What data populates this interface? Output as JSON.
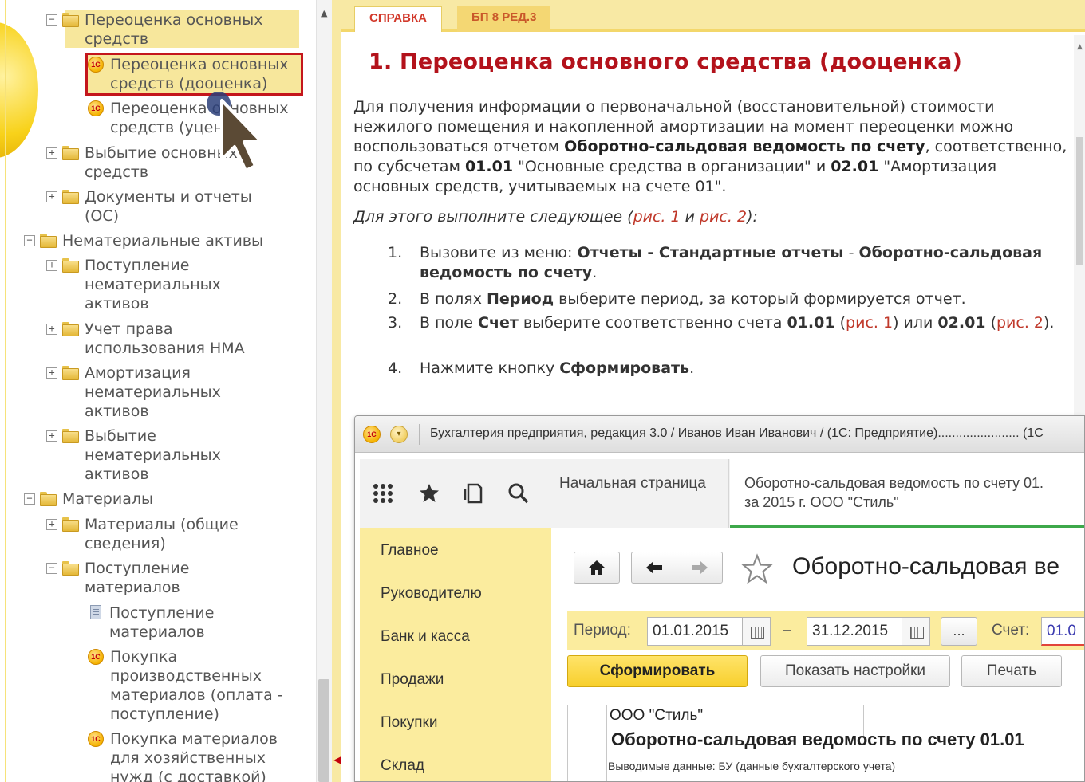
{
  "tree": {
    "items": [
      {
        "toggle": "−",
        "icon": "folder",
        "label": "Переоценка основных\nсредств"
      },
      {
        "toggle": "",
        "icon": "1c",
        "label": "Переоценка основных\nсредств (дооценка)"
      },
      {
        "toggle": "",
        "icon": "1c",
        "label": "Переоценка основных\nсредств (уценка)"
      },
      {
        "toggle": "+",
        "icon": "folder",
        "label": "Выбытие основных\nсредств"
      },
      {
        "toggle": "+",
        "icon": "folder",
        "label": "Документы и отчеты\n(ОС)"
      },
      {
        "toggle": "−",
        "icon": "folder",
        "label": "Нематериальные активы"
      },
      {
        "toggle": "+",
        "icon": "folder",
        "label": "Поступление\nнематериальных\nактивов"
      },
      {
        "toggle": "+",
        "icon": "folder",
        "label": "Учет права\nиспользования НМА"
      },
      {
        "toggle": "+",
        "icon": "folder",
        "label": "Амортизация\nнематериальных\nактивов"
      },
      {
        "toggle": "+",
        "icon": "folder",
        "label": "Выбытие\nнематериальных\nактивов"
      },
      {
        "toggle": "−",
        "icon": "folder",
        "label": "Материалы"
      },
      {
        "toggle": "+",
        "icon": "folder",
        "label": "Материалы (общие\nсведения)"
      },
      {
        "toggle": "−",
        "icon": "folder",
        "label": "Поступление\nматериалов"
      },
      {
        "toggle": "",
        "icon": "doc",
        "label": "Поступление\nматериалов"
      },
      {
        "toggle": "",
        "icon": "1c",
        "label": "Покупка\nпроизводственных\nматериалов (оплата -\nпоступление)"
      },
      {
        "toggle": "",
        "icon": "1c",
        "label": "Покупка материалов\nдля хозяйственных\nнужд (с доставкой)"
      }
    ]
  },
  "help": {
    "tabs": [
      "СПРАВКА",
      "БП 8 РЕД.3"
    ],
    "title": "1. Переоценка основного средства (дооценка)",
    "intro_1": "Для получения информации о первоначальной (восстановительной) стоимости нежилого помещения и накопленной амортизации на момент переоценки можно воспользоваться отчетом ",
    "intro_report": "Оборотно-сальдовая ведомость по счету",
    "intro_2": ", соответственно, по субсчетам ",
    "intro_acc1": "01.01",
    "intro_3": " \"Основные средства в организации\" и ",
    "intro_acc2": "02.01",
    "intro_4": " \"Амортизация основных средств, учитываемых на счете 01\".",
    "do_text": "Для этого выполните следующее (",
    "do_fig1": "рис. 1",
    "do_and": " и ",
    "do_fig2": "рис. 2",
    "do_end": "):",
    "steps": [
      {
        "num": "1.",
        "a": "Вызовите из меню: ",
        "b": "Отчеты - Стандартные отчеты",
        "c": " - ",
        "d": "Оборотно-сальдовая ведомость по счету",
        "e": "."
      },
      {
        "num": "2.",
        "a": "В полях ",
        "b": "Период",
        "c": " выберите период, за который формируется отчет."
      },
      {
        "num": "3.",
        "a": "В поле ",
        "b": "Счет",
        "c": " выберите соответственно счета ",
        "d": "01.01",
        "e": " (",
        "f": "рис. 1",
        "g": ") или ",
        "h": "02.01",
        "i": " (",
        "j": "рис. 2",
        "k": ")."
      },
      {
        "num": "4.",
        "a": "Нажмите кнопку ",
        "b": "Сформировать",
        "c": "."
      }
    ]
  },
  "screenshot": {
    "window_title": "Бухгалтерия предприятия, редакция 3.0 / Иванов Иван Иванович / (1С: Предприятие)....................... (1С",
    "home_tab": "Начальная страница",
    "report_tab_line1": "Оборотно-сальдовая ведомость по счету 01.",
    "report_tab_line2": "за 2015 г. ООО \"Стиль\"",
    "sections": [
      "Главное",
      "Руководителю",
      "Банк и касса",
      "Продажи",
      "Покупки",
      "Склад"
    ],
    "form_title": "Оборотно-сальдовая ве",
    "period_label": "Период:",
    "date_from": "01.01.2015",
    "dash": "–",
    "date_to": "31.12.2015",
    "dots": "...",
    "account_label": "Счет:",
    "account_value": "01.0",
    "btn_generate": "Сформировать",
    "btn_settings": "Показать настройки",
    "btn_print": "Печать",
    "report_org": "ООО \"Стиль\"",
    "report_title": "Оборотно-сальдовая ведомость по счету 01.01",
    "report_output": "Выводимые данные:  БУ (данные бухгалтерского учета)"
  },
  "colors": {
    "accent": "#b3121b",
    "panel_yellow": "#fbec9e",
    "link": "#c0392b",
    "green_tab": "#3da84a"
  }
}
